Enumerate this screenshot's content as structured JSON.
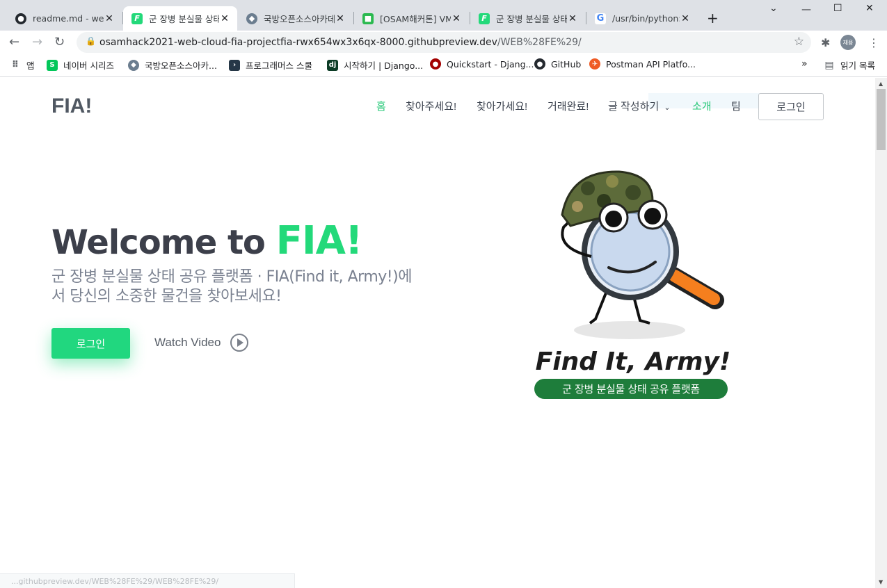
{
  "browser": {
    "tabs": [
      {
        "title": "readme.md - web_",
        "active": false
      },
      {
        "title": "군 장병 분실물 상태",
        "active": true
      },
      {
        "title": "국방오픈소스아카데",
        "active": false
      },
      {
        "title": "[OSAM해커톤] VM",
        "active": false
      },
      {
        "title": "군 장병 분실물 상태",
        "active": false
      },
      {
        "title": "/usr/bin/python: n",
        "active": false
      }
    ],
    "new_tab": "+",
    "url_host": "osamhack2021-web-cloud-fia-projectfia-rwx654wx3x6qx-8000.githubpreview.dev",
    "url_path": "/WEB%28FE%29/",
    "profile": "재용",
    "bookmarks": [
      {
        "label": "앱"
      },
      {
        "label": "네이버 시리즈"
      },
      {
        "label": "국방오픈소스아카..."
      },
      {
        "label": "프로그래머스 스쿨"
      },
      {
        "label": "시작하기 | Django..."
      },
      {
        "label": "Quickstart - Djang..."
      },
      {
        "label": "GitHub"
      },
      {
        "label": "Postman API Platfo..."
      }
    ],
    "overflow": "»",
    "reading_list": "읽기 목록"
  },
  "site": {
    "logo": "FIA!",
    "nav": [
      {
        "label": "홈",
        "active": true
      },
      {
        "label": "찾아주세요!",
        "active": false
      },
      {
        "label": "찾아가세요!",
        "active": false
      },
      {
        "label": "거래완료!",
        "active": false
      },
      {
        "label": "글 작성하기",
        "active": false,
        "dropdown": true
      },
      {
        "label": "소개",
        "active": true
      },
      {
        "label": "팀",
        "active": false
      }
    ],
    "login_label": "로그인"
  },
  "hero": {
    "title_prefix": "Welcome to ",
    "title_brand": "FIA!",
    "subtitle": "군 장병 분실물 상태 공유 플랫폼 · FIA(Find it, Army!)에서 당신의 소중한 물건을 찾아보세요!",
    "cta_label": "로그인",
    "watch_label": "Watch Video",
    "art_title": "Find It, Army!",
    "art_tagline": "군 장병 분실물 상태 공유 플랫폼"
  },
  "status_url": "...githubpreview.dev/WEB%28FE%29/WEB%28FE%29/",
  "colors": {
    "brand_green": "#23d97a",
    "cta_green": "#21d77f",
    "nav_active": "#23c776",
    "heading": "#3c3f4a"
  }
}
